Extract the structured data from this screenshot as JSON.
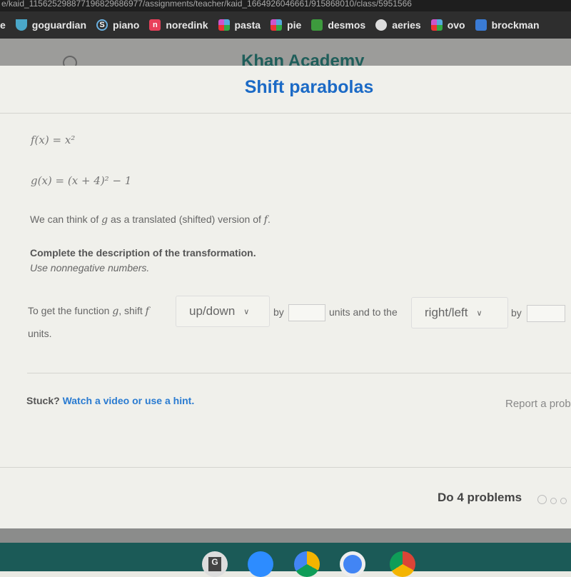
{
  "browser": {
    "url": "e/kaid_115625298877196829686977/assignments/teacher/kaid_1664926046661/915868010/class/5951566",
    "bookmarks": [
      {
        "label": "e",
        "icon": "none"
      },
      {
        "label": "goguardian",
        "icon": "shield-icon",
        "color": "#4aa7c9"
      },
      {
        "label": "piano",
        "icon": "s-circle-icon",
        "color": "#6ab0e0"
      },
      {
        "label": "noredink",
        "icon": "n-icon",
        "color": "#e8405a"
      },
      {
        "label": "pasta",
        "icon": "game-icon",
        "color": "#e8b830"
      },
      {
        "label": "pie",
        "icon": "game-icon",
        "color": "#e8b830"
      },
      {
        "label": "desmos",
        "icon": "desmos-icon",
        "color": "#3d9a3d"
      },
      {
        "label": "aeries",
        "icon": "globe-icon",
        "color": "#ddd"
      },
      {
        "label": "ovo",
        "icon": "game-icon",
        "color": "#e8b830"
      },
      {
        "label": "brockman",
        "icon": "calendar-icon",
        "color": "#3a7bd5"
      }
    ]
  },
  "site": {
    "logo": "Khan Academy"
  },
  "exercise": {
    "title": "Shift parabolas",
    "f_def": "f(x) = x²",
    "g_def": "g(x) = (x + 4)² − 1",
    "intro_pre": "We can think of ",
    "intro_g": "g",
    "intro_mid": " as a translated (shifted) version of ",
    "intro_f": "f",
    "intro_end": ".",
    "instruction": "Complete the description of the transformation.",
    "hint_text": "Use nonnegative numbers.",
    "sentence": {
      "part1": "To get the function ",
      "g": "g",
      "part2": ", shift ",
      "f": "f",
      "dropdown1": "up/down",
      "by1": "by",
      "part3": "units and to the",
      "dropdown2": "right/left",
      "by2": "by",
      "part4": "units.",
      "input1": "",
      "input2": ""
    },
    "stuck": "Stuck?",
    "help_link": "Watch a video or use a hint.",
    "report": "Report a problem",
    "goal": "Do 4 problems"
  },
  "taskbar": [
    {
      "label": "G",
      "icon": "classroom-icon"
    },
    {
      "icon": "zoom-icon"
    },
    {
      "icon": "drive-icon"
    },
    {
      "icon": "docs-icon"
    },
    {
      "icon": "chrome-icon"
    }
  ]
}
